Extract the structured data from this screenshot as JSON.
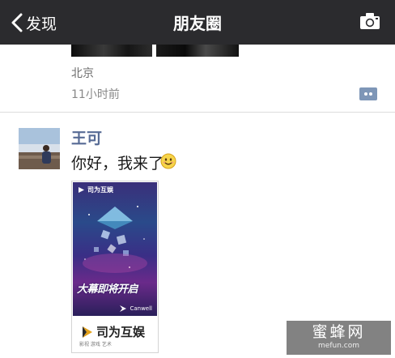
{
  "navbar": {
    "back_label": "发现",
    "title": "朋友圈"
  },
  "previous_post": {
    "location": "北京",
    "time": "11小时前"
  },
  "post": {
    "username": "王可",
    "text": "你好，我来了",
    "ad": {
      "brand_top": "司为互娱",
      "headline": "大幕即将开启",
      "canwell": "Canwell",
      "footer_logo": "司为互娱",
      "footer_sub": "影视 游戏 艺术"
    }
  },
  "watermark": {
    "cn": "蜜蜂网",
    "en": "mefun.com"
  },
  "colors": {
    "navbar_bg": "#2b2b2e",
    "username": "#576b95",
    "comment_button": "#7e96b7"
  },
  "icons": [
    "chevron-left-icon",
    "camera-icon",
    "comment-icon",
    "smile-emoji-icon"
  ]
}
